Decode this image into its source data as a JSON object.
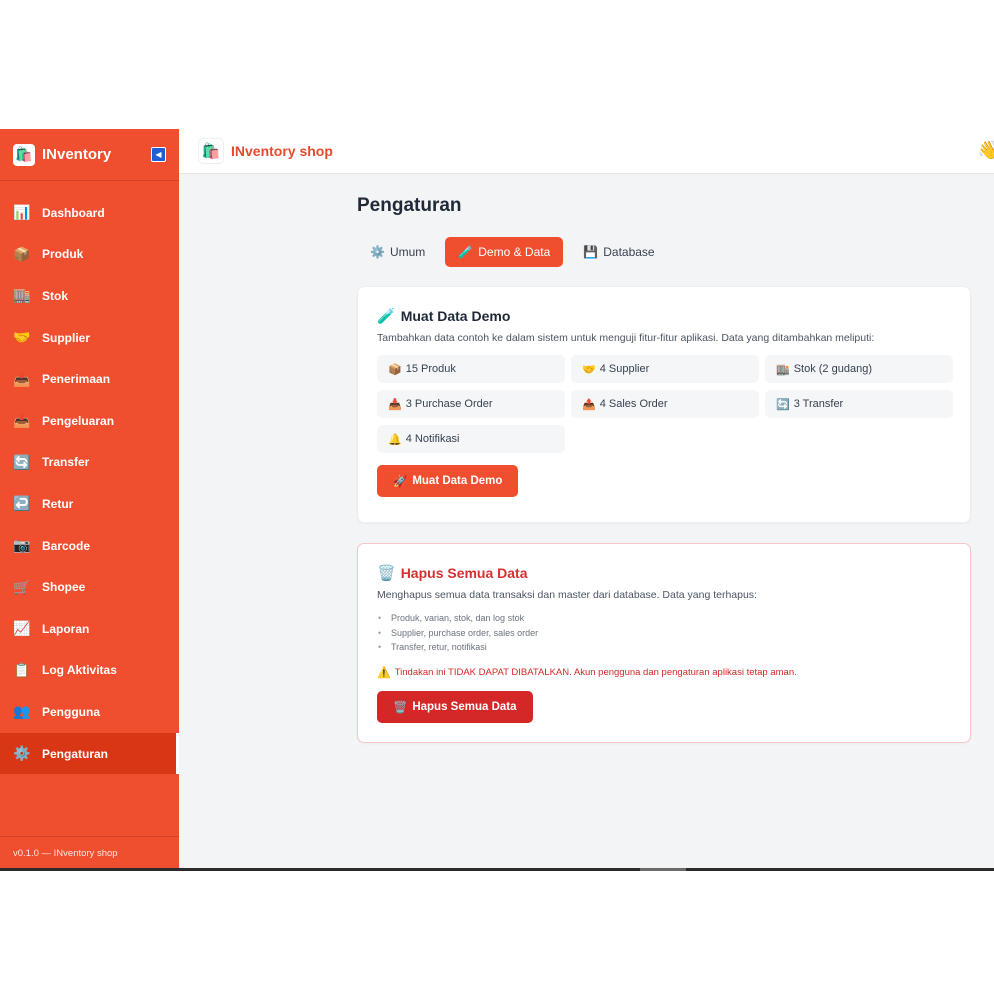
{
  "sidebar": {
    "title": "INventory",
    "items": [
      {
        "icon": "📊",
        "label": "Dashboard"
      },
      {
        "icon": "📦",
        "label": "Produk"
      },
      {
        "icon": "🏬",
        "label": "Stok"
      },
      {
        "icon": "🤝",
        "label": "Supplier"
      },
      {
        "icon": "📥",
        "label": "Penerimaan"
      },
      {
        "icon": "📤",
        "label": "Pengeluaran"
      },
      {
        "icon": "🔄",
        "label": "Transfer"
      },
      {
        "icon": "↩️",
        "label": "Retur"
      },
      {
        "icon": "📷",
        "label": "Barcode"
      },
      {
        "icon": "🛒",
        "label": "Shopee"
      },
      {
        "icon": "📈",
        "label": "Laporan"
      },
      {
        "icon": "📋",
        "label": "Log Aktivitas"
      },
      {
        "icon": "👥",
        "label": "Pengguna"
      },
      {
        "icon": "⚙️",
        "label": "Pengaturan"
      }
    ],
    "footer": "v0.1.0 — INventory shop"
  },
  "topbar": {
    "shop_name": "INventory shop"
  },
  "page": {
    "title": "Pengaturan"
  },
  "tabs": [
    {
      "icon": "⚙️",
      "label": "Umum"
    },
    {
      "icon": "🧪",
      "label": "Demo & Data"
    },
    {
      "icon": "💾",
      "label": "Database"
    }
  ],
  "demo": {
    "title": "Muat Data Demo",
    "icon": "🧪",
    "description": "Tambahkan data contoh ke dalam sistem untuk menguji fitur-fitur aplikasi. Data yang ditambahkan meliputi:",
    "items": [
      {
        "icon": "📦",
        "label": "15 Produk"
      },
      {
        "icon": "🤝",
        "label": "4 Supplier"
      },
      {
        "icon": "🏬",
        "label": "Stok (2 gudang)"
      },
      {
        "icon": "📥",
        "label": "3 Purchase Order"
      },
      {
        "icon": "📤",
        "label": "4 Sales Order"
      },
      {
        "icon": "🔄",
        "label": "3 Transfer"
      },
      {
        "icon": "🔔",
        "label": "4 Notifikasi"
      }
    ],
    "button": "Muat Data Demo",
    "button_icon": "🚀"
  },
  "danger": {
    "title": "Hapus Semua Data",
    "icon": "🗑️",
    "description": "Menghapus semua data transaksi dan master dari database. Data yang terhapus:",
    "list": [
      "Produk, varian, stok, dan log stok",
      "Supplier, purchase order, sales order",
      "Transfer, retur, notifikasi"
    ],
    "warning": "Tindakan ini TIDAK DAPAT DIBATALKAN. Akun pengguna dan pengaturan aplikasi tetap aman.",
    "warning_icon": "⚠️",
    "button": "Hapus Semua Data",
    "button_icon": "🗑️"
  }
}
